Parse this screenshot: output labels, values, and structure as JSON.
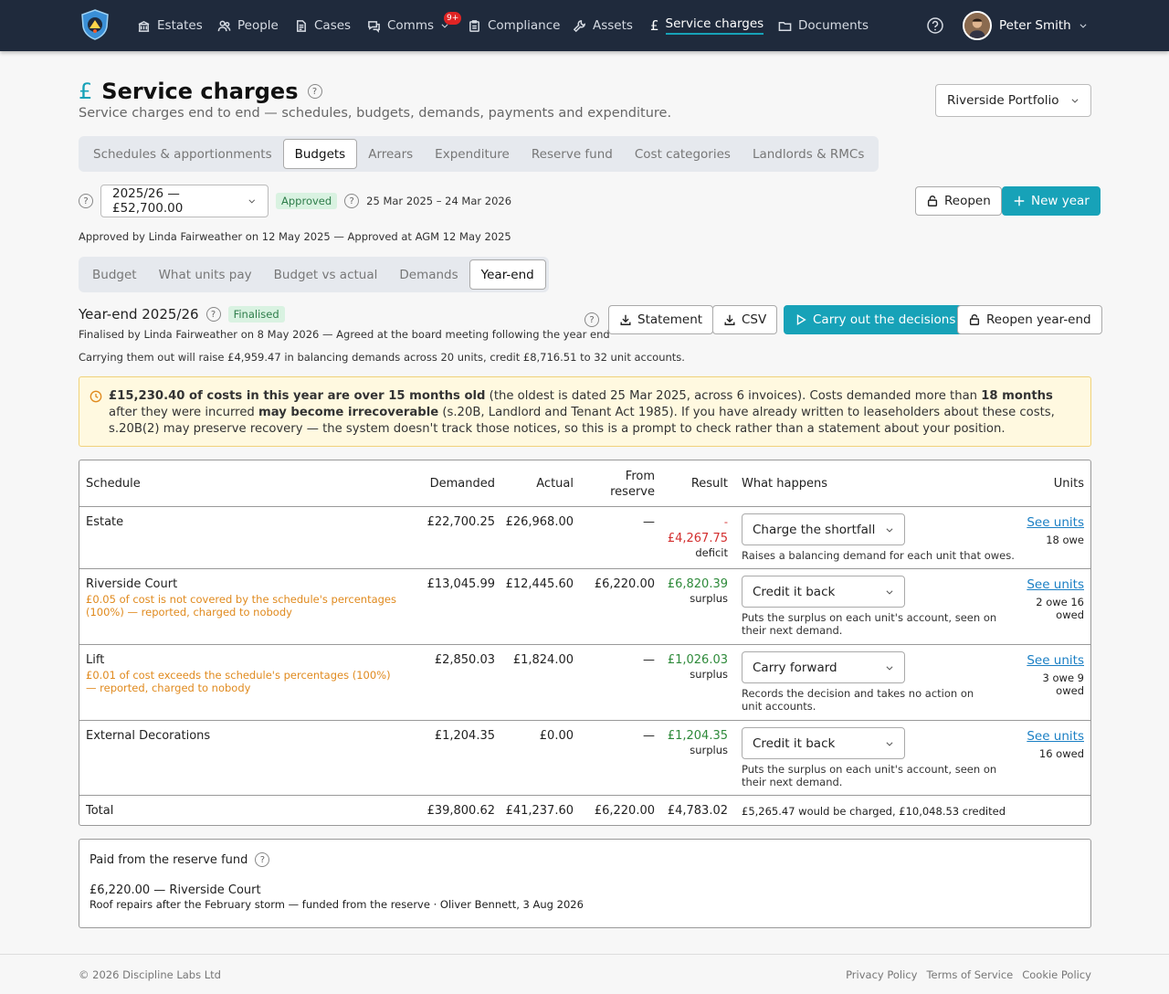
{
  "nav": {
    "items": [
      {
        "label": "Estates",
        "icon": "building-icon"
      },
      {
        "label": "People",
        "icon": "people-icon"
      },
      {
        "label": "Cases",
        "icon": "document-icon"
      },
      {
        "label": "Comms",
        "icon": "chat-icon"
      },
      {
        "label": "Compliance",
        "icon": "clipboard-icon"
      },
      {
        "label": "Assets",
        "icon": "wrench-icon"
      },
      {
        "label": "Service charges",
        "icon": "pound-icon"
      },
      {
        "label": "Documents",
        "icon": "folder-icon"
      }
    ],
    "comms_badge": "9+",
    "user": "Peter Smith"
  },
  "page": {
    "title": "Service charges",
    "subtitle": "Service charges end to end — schedules, budgets, demands, payments and expenditure.",
    "portfolio": "Riverside Portfolio"
  },
  "tabs": [
    "Schedules & apportionments",
    "Budgets",
    "Arrears",
    "Expenditure",
    "Reserve fund",
    "Cost categories",
    "Landlords & RMCs"
  ],
  "year": {
    "select": "2025/26 — £52,700.00",
    "status": "Approved",
    "dates": "25 Mar 2025 – 24 Mar 2026",
    "reopen": "Reopen",
    "new_year": "New year",
    "approved_line": "Approved by Linda Fairweather on 12 May 2025 — Approved at AGM 12 May 2025"
  },
  "subtabs": [
    "Budget",
    "What units pay",
    "Budget vs actual",
    "Demands",
    "Year-end"
  ],
  "yearend": {
    "title": "Year-end 2025/26",
    "status": "Finalised",
    "finalised": "Finalised by Linda Fairweather on 8 May 2026 — Agreed at the board meeting following the year end",
    "carry": "Carrying them out will raise £4,959.47 in balancing demands across 20 units, credit £8,716.51 to 32 unit accounts.",
    "statement": "Statement",
    "csv": "CSV",
    "carry_btn": "Carry out the decisions",
    "reopen_btn": "Reopen year-end"
  },
  "warning": {
    "b1": "£15,230.40 of costs in this year are over 15 months old",
    "t1": " (the oldest is dated 25 Mar 2025, across 6 invoices). Costs demanded more than ",
    "b2": "18 months",
    "t2": " after they were incurred ",
    "b3": "may become irrecoverable",
    "t3": " (s.20B, Landlord and Tenant Act 1985). If you have already written to leaseholders about these costs, s.20B(2) may preserve recovery — the system doesn't track those notices, so this is a prompt to check rather than a statement about your position."
  },
  "table": {
    "headers": {
      "schedule": "Schedule",
      "demanded": "Demanded",
      "actual": "Actual",
      "from1": "From",
      "from2": "reserve",
      "result": "Result",
      "what": "What happens",
      "units": "Units"
    },
    "rows": [
      {
        "name": "Estate",
        "note": "",
        "demanded": "£22,700.25",
        "actual": "£26,968.00",
        "reserve": "—",
        "sign": "-",
        "result": "£4,267.75",
        "rlabel": "deficit",
        "action": "Charge the shortfall",
        "desc": "Raises a balancing demand for each unit that owes.",
        "link": "See units",
        "units": "18 owe"
      },
      {
        "name": "Riverside Court",
        "note": "£0.05 of cost is not covered by the schedule's percentages (100%) — reported, charged to nobody",
        "demanded": "£13,045.99",
        "actual": "£12,445.60",
        "reserve": "£6,220.00",
        "sign": "",
        "result": "£6,820.39",
        "rlabel": "surplus",
        "action": "Credit it back",
        "desc": "Puts the surplus on each unit's account, seen on their next demand.",
        "link": "See units",
        "units": "2 owe 16 owed"
      },
      {
        "name": "Lift",
        "note": "£0.01 of cost exceeds the schedule's percentages (100%) — reported, charged to nobody",
        "demanded": "£2,850.03",
        "actual": "£1,824.00",
        "reserve": "—",
        "sign": "",
        "result": "£1,026.03",
        "rlabel": "surplus",
        "action": "Carry forward",
        "desc": "Records the decision and takes no action on unit accounts.",
        "link": "See units",
        "units": "3 owe 9 owed"
      },
      {
        "name": "External Decorations",
        "note": "",
        "demanded": "£1,204.35",
        "actual": "£0.00",
        "reserve": "—",
        "sign": "",
        "result": "£1,204.35",
        "rlabel": "surplus",
        "action": "Credit it back",
        "desc": "Puts the surplus on each unit's account, seen on their next demand.",
        "link": "See units",
        "units": "16 owed"
      }
    ],
    "total": {
      "label": "Total",
      "demanded": "£39,800.62",
      "actual": "£41,237.60",
      "reserve": "£6,220.00",
      "result": "£4,783.02",
      "summary": "£5,265.47 would be charged, £10,048.53 credited"
    }
  },
  "reserve": {
    "title": "Paid from the reserve fund",
    "item": "£6,220.00 — Riverside Court",
    "detail": "Roof repairs after the February storm — funded from the reserve · Oliver Bennett, 3 Aug 2026"
  },
  "footer": {
    "copyright": "© 2026 Discipline Labs Ltd",
    "links": [
      "Privacy Policy",
      "Terms of Service",
      "Cookie Policy"
    ]
  },
  "colors": {
    "accent": "#17a2b8",
    "nav": "#1f2a3c",
    "deficit": "#d32f2f",
    "surplus": "#2e8a3a",
    "warning": "#e08a1e"
  }
}
